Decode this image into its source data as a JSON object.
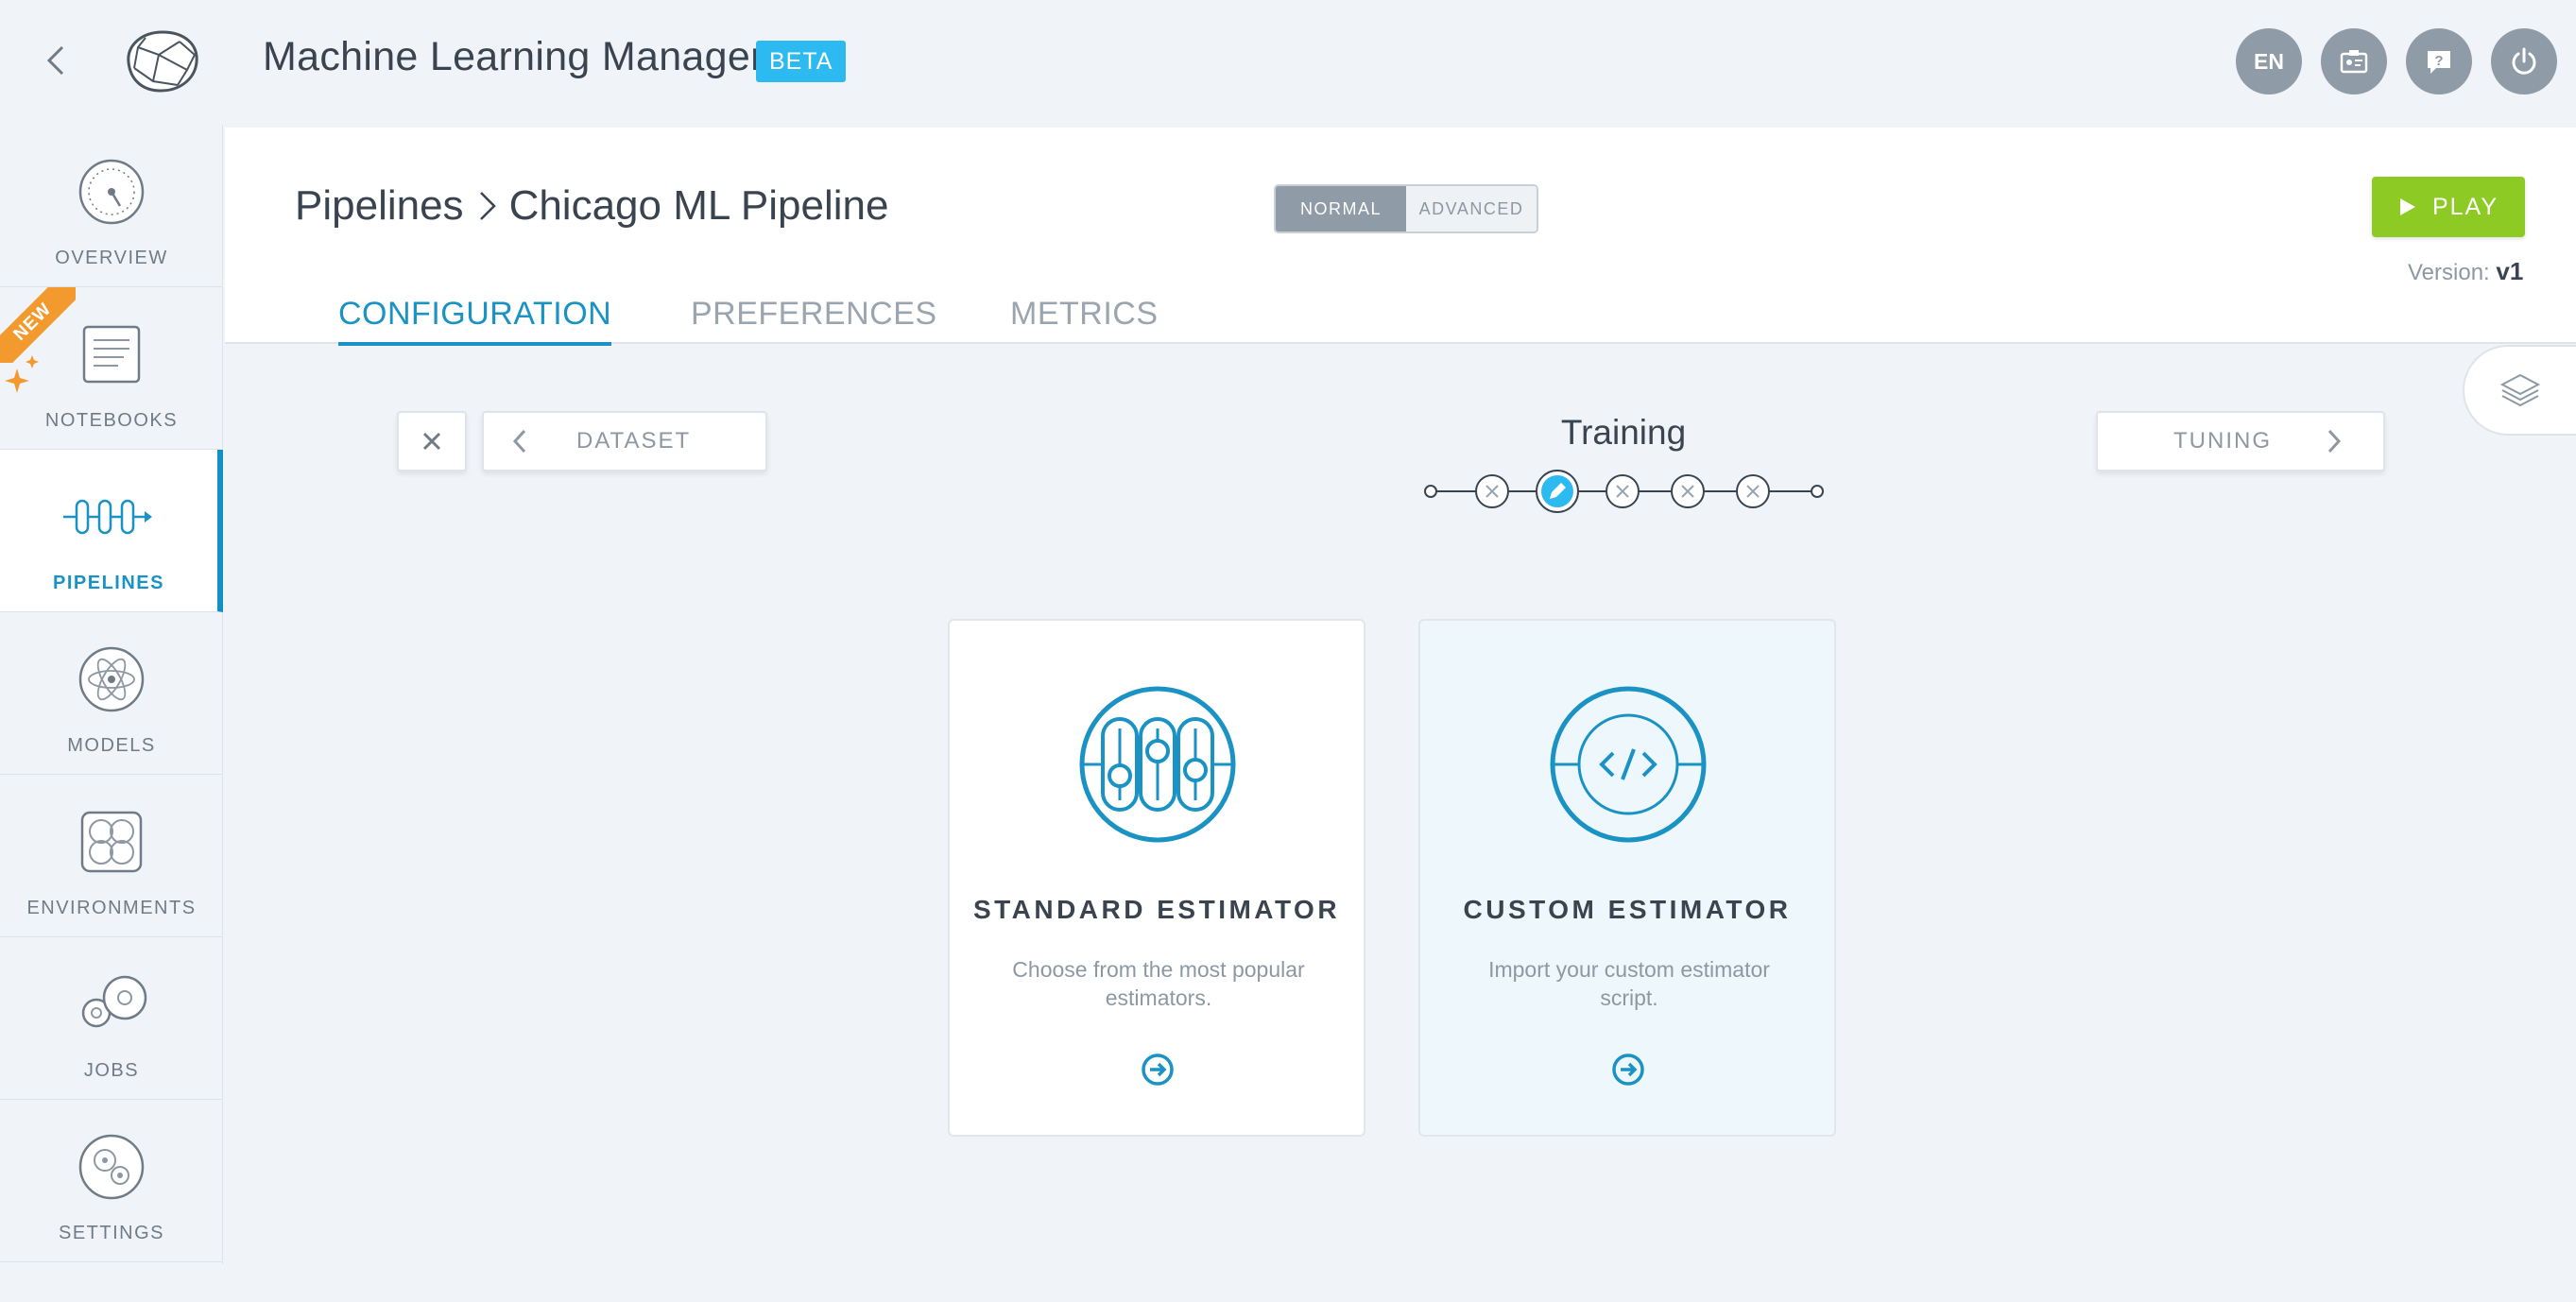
{
  "app": {
    "title": "Machine Learning Manager",
    "badge": "BETA",
    "language": "EN"
  },
  "sidebar": {
    "items": [
      {
        "label": "OVERVIEW"
      },
      {
        "label": "NOTEBOOKS",
        "ribbon": "NEW"
      },
      {
        "label": "PIPELINES"
      },
      {
        "label": "MODELS"
      },
      {
        "label": "ENVIRONMENTS"
      },
      {
        "label": "JOBS"
      },
      {
        "label": "SETTINGS"
      }
    ]
  },
  "header": {
    "breadcrumb": [
      "Pipelines",
      "Chicago ML Pipeline"
    ],
    "mode_normal": "NORMAL",
    "mode_advanced": "ADVANCED",
    "play_label": "PLAY",
    "version_label": "Version:",
    "version_value": "v1",
    "tabs": [
      {
        "label": "CONFIGURATION"
      },
      {
        "label": "PREFERENCES"
      },
      {
        "label": "METRICS"
      }
    ]
  },
  "stepper": {
    "title": "Training",
    "prev_label": "DATASET",
    "next_label": "TUNING"
  },
  "cards": [
    {
      "title": "STANDARD ESTIMATOR",
      "description": "Choose from the most popular estimators."
    },
    {
      "title": "CUSTOM ESTIMATOR",
      "description": "Import your custom estimator script."
    }
  ],
  "colors": {
    "accent": "#1a93c4",
    "play": "#8dcb24",
    "beta": "#2cbaf0",
    "ribbon": "#f29a2e"
  }
}
